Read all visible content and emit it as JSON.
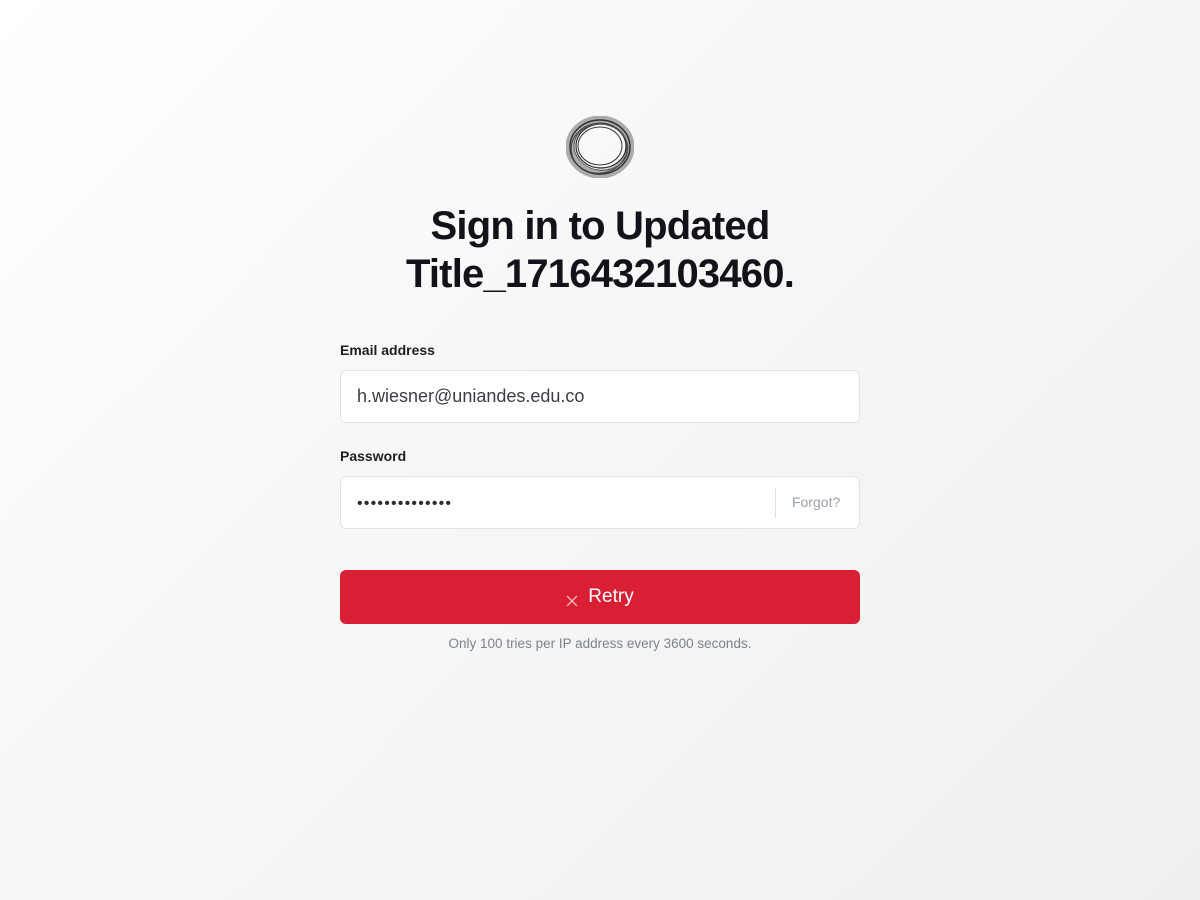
{
  "title": "Sign in to Updated Title_1716432103460.",
  "logo": {
    "icon": "circle-ring-logo"
  },
  "form": {
    "email_label": "Email address",
    "email_value": "h.wiesner@uniandes.edu.co",
    "password_label": "Password",
    "password_value": "••••••••••••••",
    "forgot_label": "Forgot?"
  },
  "retry_button": {
    "label": "Retry",
    "icon": "close-icon",
    "color": "#d81f33"
  },
  "rate_limit_note": "Only 100 tries per IP address every 3600 seconds."
}
